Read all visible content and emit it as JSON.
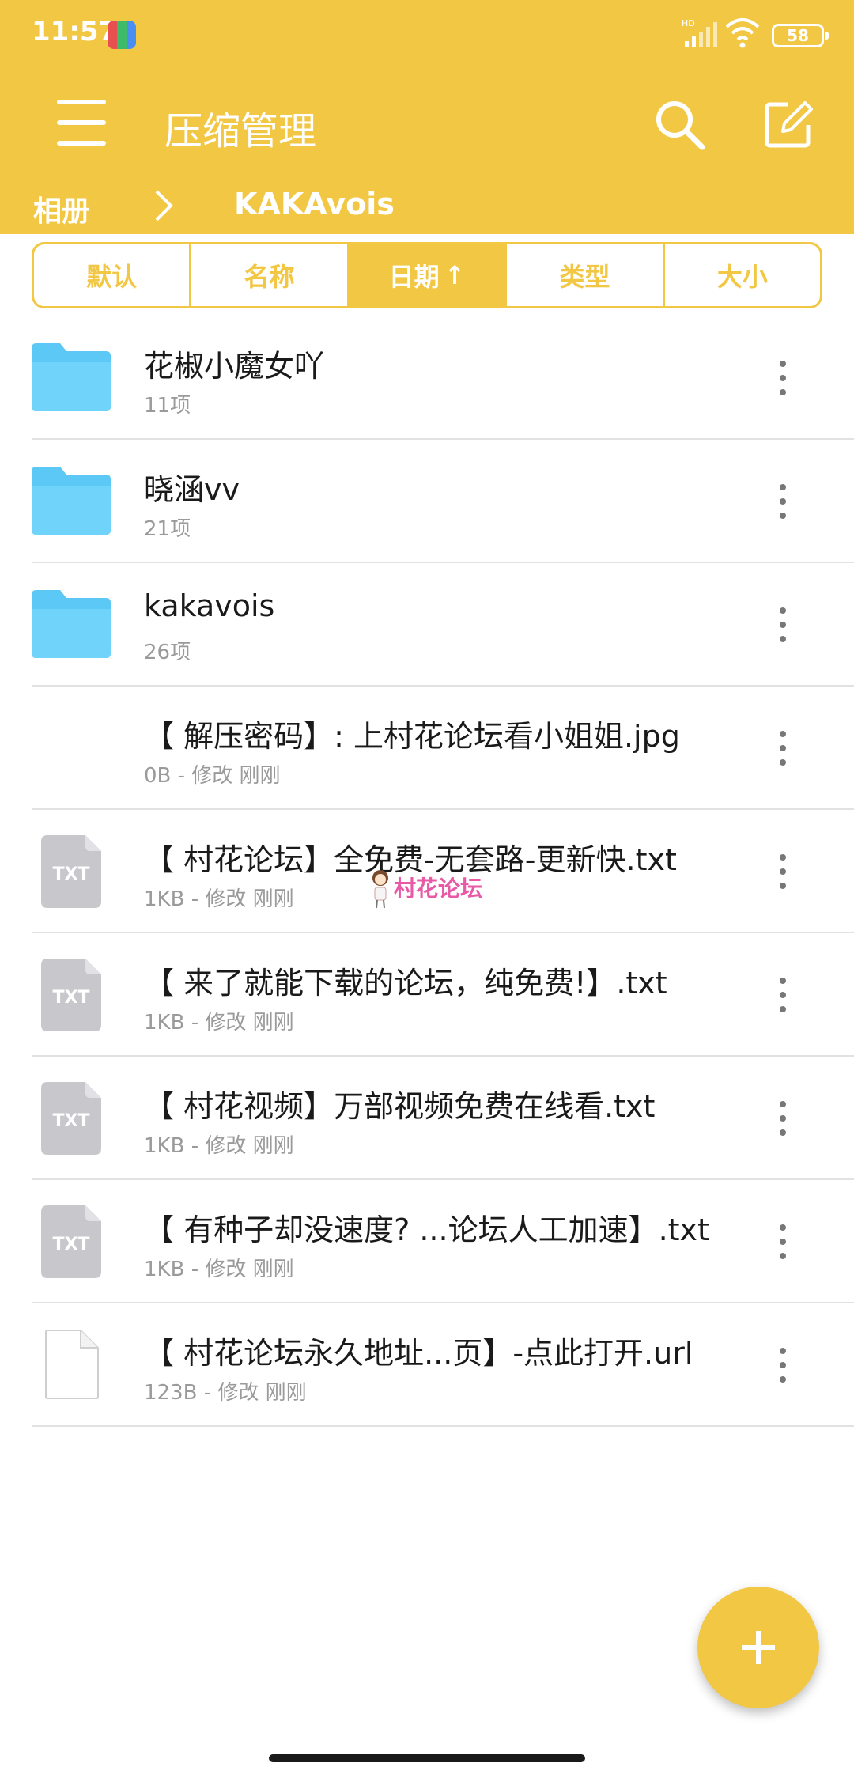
{
  "status_bar": {
    "time": "11:57",
    "network": "HD",
    "battery": "58"
  },
  "toolbar": {
    "title": "压缩管理",
    "menu_icon": "hamburger-menu-icon",
    "search_icon": "search-icon",
    "edit_icon": "edit-icon"
  },
  "breadcrumb": {
    "root": "相册",
    "current": "KAKAvois"
  },
  "sort_tabs": [
    {
      "label": "默认",
      "active": false
    },
    {
      "label": "名称",
      "active": false
    },
    {
      "label": "日期",
      "active": true,
      "arrow": "↑"
    },
    {
      "label": "类型",
      "active": false
    },
    {
      "label": "大小",
      "active": false
    }
  ],
  "files": [
    {
      "name": "花椒小魔女吖",
      "meta": "11项",
      "type": "folder"
    },
    {
      "name": "晓涵vv",
      "meta": "21项",
      "type": "folder"
    },
    {
      "name": "kakavois",
      "meta": "26项",
      "type": "folder"
    },
    {
      "name": "【 解压密码】: 上村花论坛看小姐姐.jpg",
      "meta": "0B - 修改 刚刚",
      "type": "image"
    },
    {
      "name": "【 村花论坛】全免费-无套路-更新快.txt",
      "meta": "1KB - 修改 刚刚",
      "type": "txt"
    },
    {
      "name": "【 来了就能下载的论坛，纯免费!】.txt",
      "meta": "1KB - 修改 刚刚",
      "type": "txt"
    },
    {
      "name": "【 村花视频】万部视频免费在线看.txt",
      "meta": "1KB - 修改 刚刚",
      "type": "txt"
    },
    {
      "name": "【 有种子却没速度? ...论坛人工加速】.txt",
      "meta": "1KB - 修改 刚刚",
      "type": "txt"
    },
    {
      "name": "【 村花论坛永久地址...页】-点此打开.url",
      "meta": "123B - 修改 刚刚",
      "type": "url"
    }
  ],
  "txt_label": "TXT",
  "watermark": "村花论坛",
  "colors": {
    "accent": "#F2C744",
    "folder": "#5BC8F5",
    "txt_icon": "#C8C8CC",
    "watermark": "#E85AA6"
  }
}
